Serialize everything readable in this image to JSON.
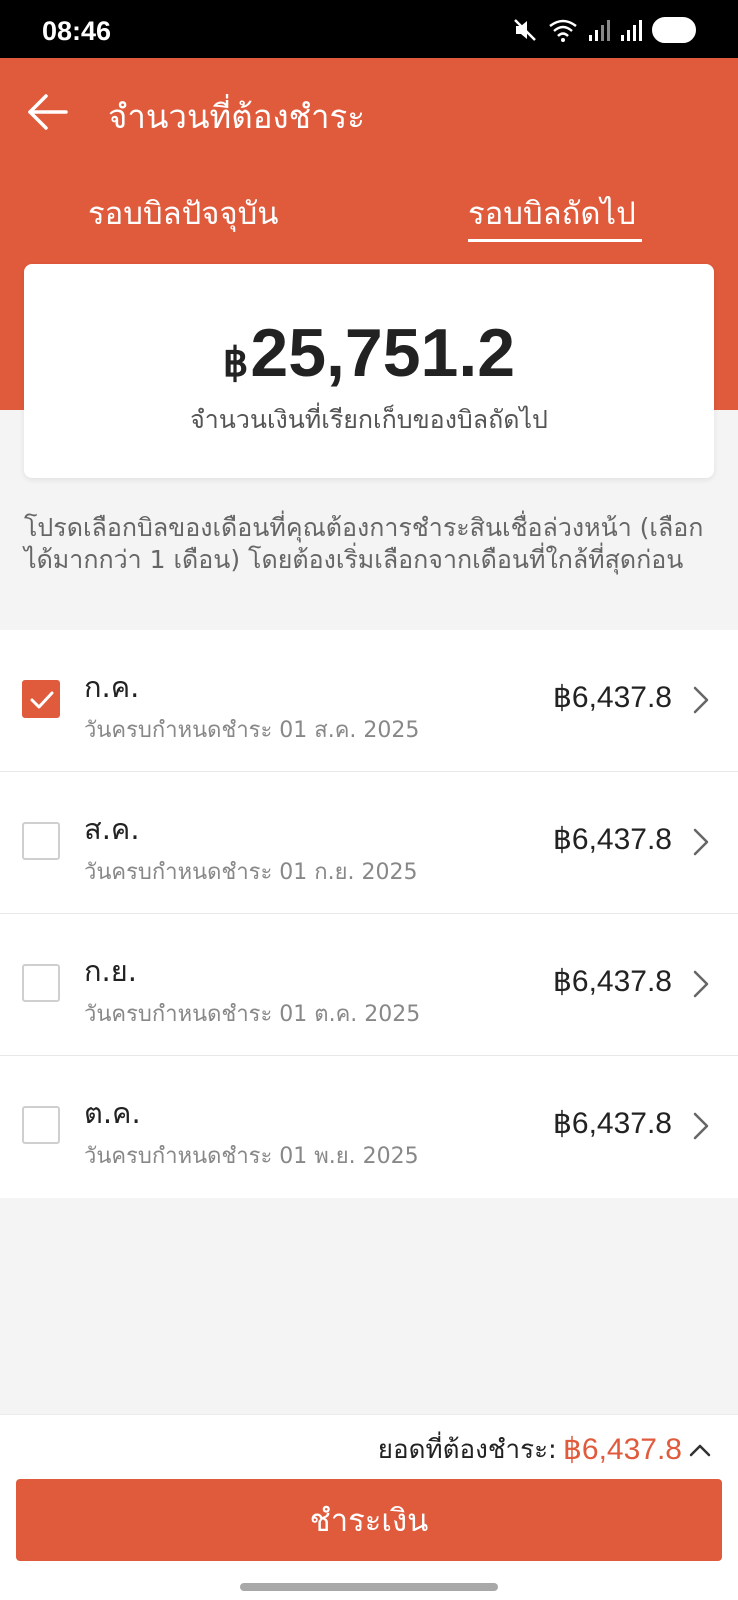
{
  "status_bar": {
    "time": "08:46"
  },
  "header": {
    "title": "จำนวนที่ต้องชำระ"
  },
  "tabs": [
    {
      "label": "รอบบิลปัจจุบัน",
      "active": false
    },
    {
      "label": "รอบบิลถัดไป",
      "active": true
    }
  ],
  "summary": {
    "currency": "฿",
    "amount": "25,751.2",
    "caption": "จำนวนเงินที่เรียกเก็บของบิลถัดไป"
  },
  "instruction": "โปรดเลือกบิลของเดือนที่คุณต้องการชำระสินเชื่อล่วงหน้า (เลือกได้มากกว่า 1 เดือน) โดยต้องเริ่มเลือกจากเดือนที่ใกล้ที่สุดก่อน",
  "bills": [
    {
      "month": "ก.ค.",
      "due": "วันครบกำหนดชำระ 01 ส.ค. 2025",
      "amount": "฿6,437.8",
      "checked": true
    },
    {
      "month": "ส.ค.",
      "due": "วันครบกำหนดชำระ 01 ก.ย. 2025",
      "amount": "฿6,437.8",
      "checked": false
    },
    {
      "month": "ก.ย.",
      "due": "วันครบกำหนดชำระ 01 ต.ค. 2025",
      "amount": "฿6,437.8",
      "checked": false
    },
    {
      "month": "ต.ค.",
      "due": "วันครบกำหนดชำระ 01 พ.ย. 2025",
      "amount": "฿6,437.8",
      "checked": false
    }
  ],
  "footer": {
    "total_label": "ยอดที่ต้องชำระ:",
    "total_amount": "฿6,437.8",
    "pay_label": "ชำระเงิน"
  },
  "colors": {
    "accent": "#e05a3c"
  }
}
